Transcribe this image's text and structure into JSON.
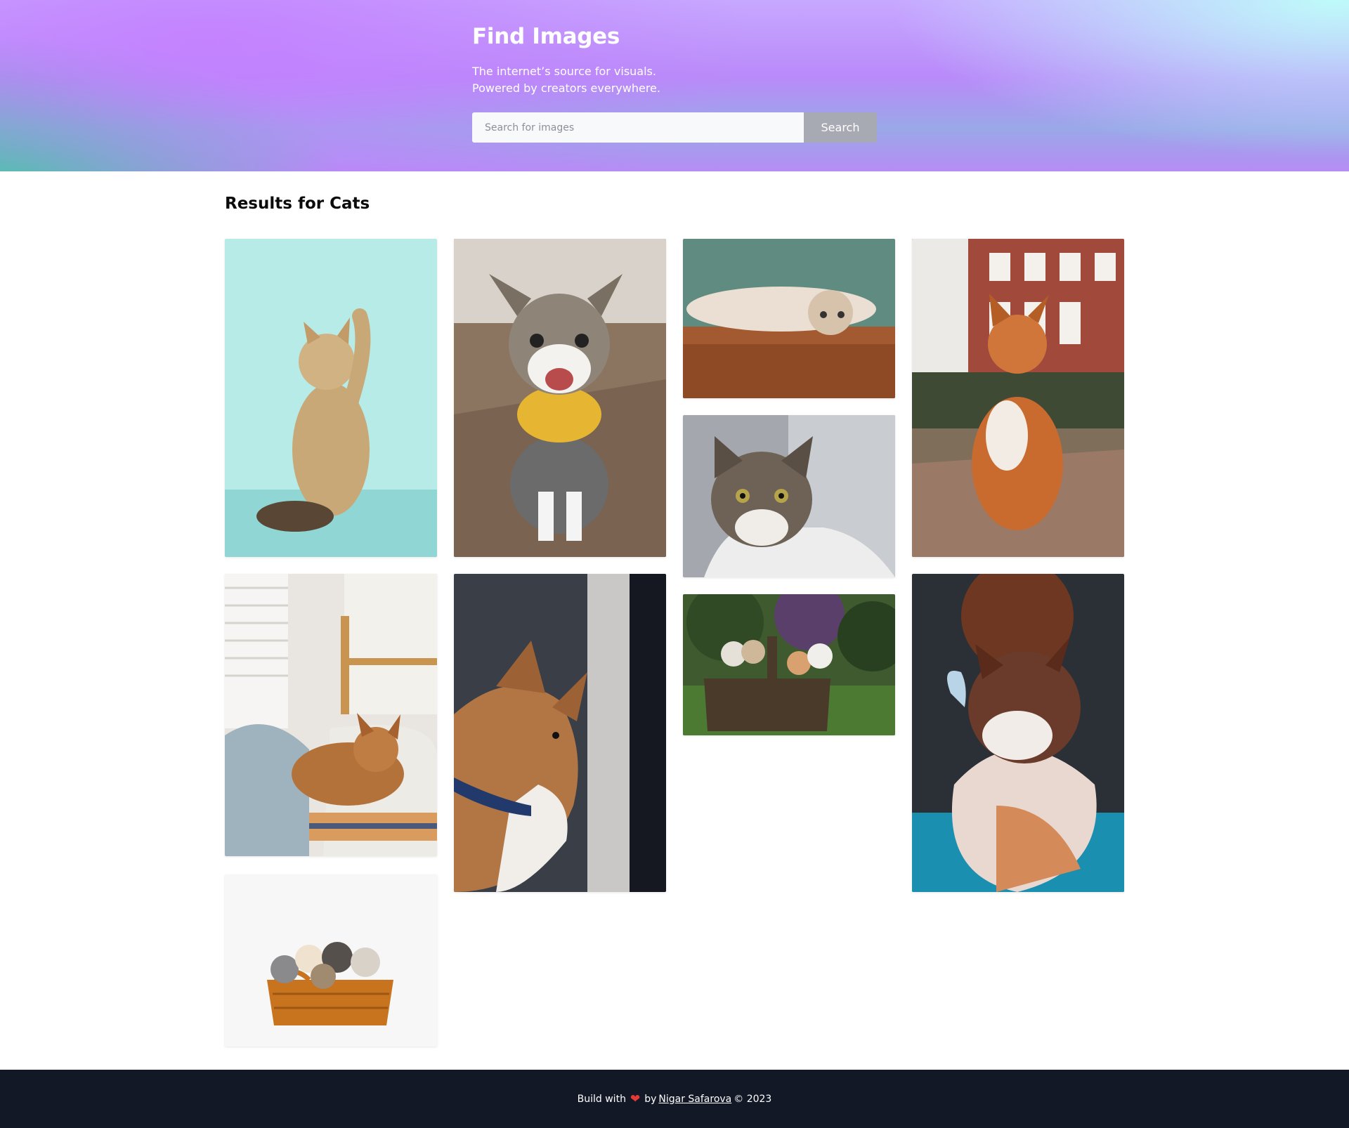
{
  "hero": {
    "title": "Find Images",
    "subtitle_line1": "The internet’s source for visuals.",
    "subtitle_line2": "Powered by creators everywhere.",
    "search_placeholder": "Search for images",
    "search_value": "",
    "search_button": "Search"
  },
  "results": {
    "heading": "Results for Cats",
    "images": [
      {
        "subject": "kitten reaching up on teal background"
      },
      {
        "subject": "happy tabby cat with yellow bandana"
      },
      {
        "subject": "cat lying upside down on wooden floor"
      },
      {
        "subject": "orange cat sitting on brick street"
      },
      {
        "subject": "tabby cat portrait"
      },
      {
        "subject": "orange cat sleeping on bed"
      },
      {
        "subject": "cat in profile with blue collar"
      },
      {
        "subject": "kittens in a basket on grass"
      },
      {
        "subject": "fluffy cat with butterfly on nose"
      },
      {
        "subject": "kittens in a wicker basket"
      }
    ]
  },
  "footer": {
    "built_with": "Build with",
    "heart_icon": "heart-icon",
    "by": "by",
    "author": "Nigar Safarova",
    "copyright": "© 2023"
  },
  "colors": {
    "footer_bg": "#131826",
    "search_button_bg": "#a7a9b3",
    "heart": "#e53935"
  }
}
